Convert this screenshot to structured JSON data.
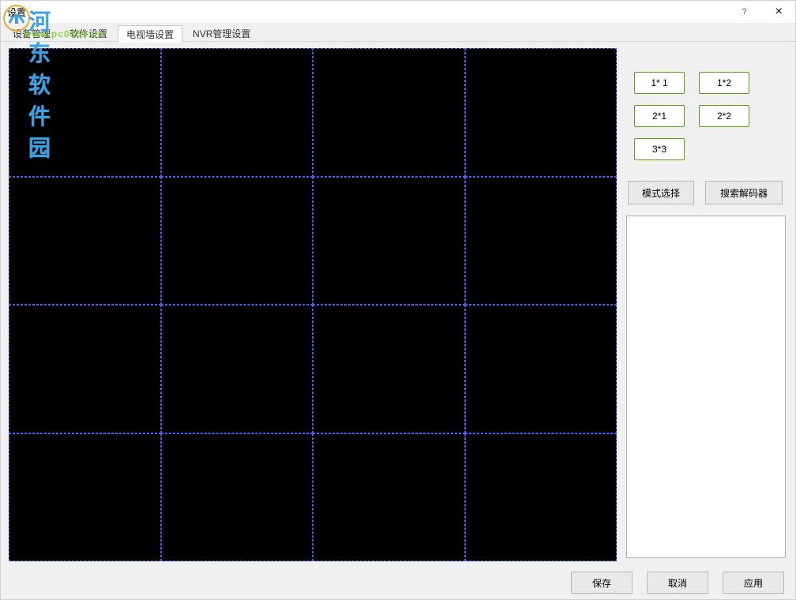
{
  "window": {
    "title": "设置"
  },
  "watermark": {
    "brand": "河东软件园",
    "url": "www.pc0359.cn"
  },
  "tabs": {
    "items": [
      {
        "label": "设备管理"
      },
      {
        "label": "软件设置"
      },
      {
        "label": "电视墙设置"
      },
      {
        "label": "NVR管理设置"
      }
    ],
    "active_index": 2
  },
  "grid": {
    "rows": 4,
    "cols": 4
  },
  "layout_buttons": [
    "1* 1",
    "1*2",
    "2*1",
    "2*2",
    "3*3"
  ],
  "mode_buttons": {
    "mode": "模式选择",
    "search": "搜索解码器"
  },
  "bottom_buttons": {
    "save": "保存",
    "cancel": "取消",
    "apply": "应用"
  },
  "titlebar_icons": {
    "help": "?",
    "close": "×"
  }
}
